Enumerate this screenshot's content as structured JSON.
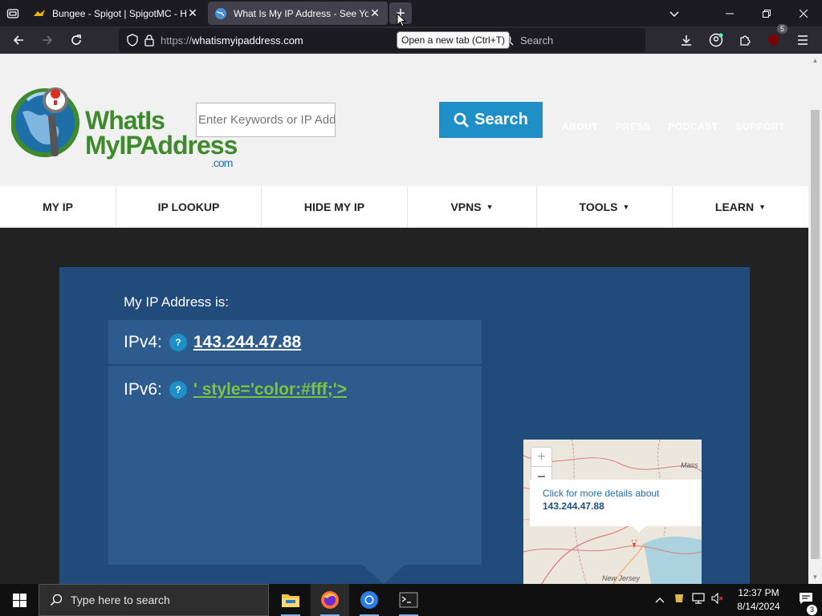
{
  "browser": {
    "tabs": [
      {
        "title": "Bungee - Spigot | SpigotMC - High",
        "active": false
      },
      {
        "title": "What Is My IP Address - See Your",
        "active": true
      }
    ],
    "url_scheme": "https://",
    "url_host": "whatismyipaddress.com",
    "search_placeholder": "Search",
    "new_tab_tooltip": "Open a new tab (Ctrl+T)",
    "extension_badge": "5"
  },
  "site": {
    "logo": {
      "line1": "WhatIs",
      "line2": "MyIPAddress",
      "line3": ".com"
    },
    "search_placeholder": "Enter Keywords or IP Address",
    "search_button": "Search",
    "top_links": [
      "ABOUT",
      "PRESS",
      "PODCAST",
      "SUPPORT"
    ],
    "main_nav": [
      {
        "label": "MY IP",
        "has_menu": false
      },
      {
        "label": "IP LOOKUP",
        "has_menu": false
      },
      {
        "label": "HIDE MY IP",
        "has_menu": false
      },
      {
        "label": "VPNS",
        "has_menu": true
      },
      {
        "label": "TOOLS",
        "has_menu": true
      },
      {
        "label": "LEARN",
        "has_menu": true
      }
    ],
    "caret": "▼"
  },
  "ip_panel": {
    "heading": "My IP Address is:",
    "ipv4_label": "IPv4:",
    "ipv4_value": "143.244.47.88",
    "ipv6_label": "IPv6:",
    "ipv6_value": "' style='color:#fff;'>",
    "help": "?"
  },
  "map": {
    "zoom_in": "+",
    "zoom_out": "−",
    "popup_text": "Click for more details about",
    "popup_ip": "143.244.47.88",
    "label_state": "New Jersey",
    "label_state2": "Mass"
  },
  "taskbar": {
    "search_placeholder": "Type here to search",
    "time": "12:37 PM",
    "date": "8/14/2024",
    "notification_count": "3"
  }
}
